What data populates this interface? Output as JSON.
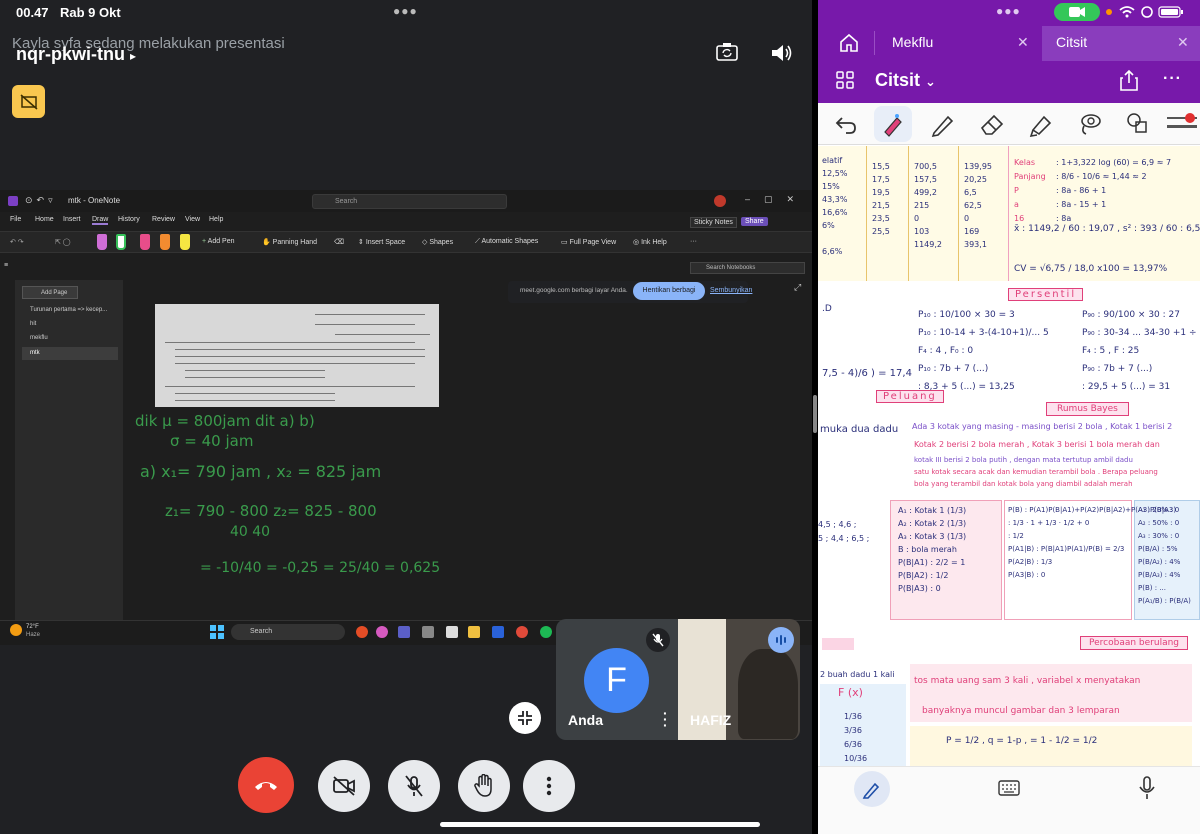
{
  "status": {
    "time": "00.47",
    "date": "Rab 9 Okt"
  },
  "meet": {
    "presenting_text": "Kayla syfa sedang melakukan presentasi",
    "meeting_code": "nqr-pkwi-tnu",
    "share_bar": {
      "text": "meet.google.com berbagi layar Anda.",
      "stop_label": "Hentikan berbagi",
      "hide_label": "Sembunyikan"
    },
    "participants": [
      {
        "name": "Anda",
        "initial": "F",
        "muted": true
      },
      {
        "name": "HAFIZ",
        "speaking": true
      }
    ],
    "controls": [
      "end-call",
      "camera-off",
      "mic-off",
      "raise-hand",
      "more-options"
    ]
  },
  "onenote_desktop": {
    "window_title": "mtk - OneNote",
    "search_placeholder": "Search",
    "menu": [
      "File",
      "Home",
      "Insert",
      "Draw",
      "History",
      "Review",
      "View",
      "Help"
    ],
    "active_menu": "Draw",
    "sticky_notes": "Sticky Notes",
    "share": "Share",
    "ribbon": {
      "add_pen": "Add Pen",
      "panning_hand": "Panning Hand",
      "insert_space": "Insert Space",
      "shapes": "Shapes",
      "automatic_shapes": "Automatic Shapes",
      "full_page_view": "Full Page View",
      "ink_help": "Ink Help"
    },
    "search_notebooks": "Search Notebooks",
    "add_page": "Add Page",
    "pages": [
      "Turunan pertama => kecep...",
      "hit",
      "mekflu",
      "mtk"
    ],
    "selected_page": "mtk",
    "handwriting": {
      "line1": "dik  μ = 800jam     dit a) b)",
      "line2": "σ = 40 jam",
      "line3": "a)  x₁= 790 jam , x₂ = 825 jam",
      "line4": "z₁= 790 - 800       z₂= 825 - 800",
      "line5": "40                              40",
      "line6": "= -10/40  = -0,25          = 25/40 = 0,625"
    }
  },
  "windows_taskbar": {
    "temperature": "72°F",
    "condition": "Haze",
    "search": "Search"
  },
  "onenote_ipad": {
    "tabs": [
      "Mekflu",
      "Citsit"
    ],
    "active_tab": "Citsit",
    "notebook_title": "Citsit",
    "headings": {
      "persentil": "Persentil",
      "peluang": "Peluang",
      "rumus_bayes": "Rumus Bayes",
      "percobaan": "Percobaan berulang"
    },
    "texts": {
      "dua_dadu": "muka dua dadu",
      "bayes_line1": "Ada 3 kotak yang masing - masing berisi 2 bola , Kotak 1 berisi 2",
      "bayes_line2": "Kotak 2 berisi 2 bola merah , Kotak 3 berisi 1 bola merah dan",
      "var_acak": "tos mata uang  sam 3 kali , variabel x menyatakan",
      "banyak_muncul": "banyaknya muncul gambar dan 3 lemparan",
      "dadu_kali": "2 buah dadu 1 kali",
      "cv": "CV = √6,75 / 18,0  x100 = 13,97%",
      "p_values": "P = 1/2 , q = 1-p , = 1 - 1/2 = 1/2",
      "fx": "F (x)",
      "fx_vals": [
        "1/36",
        "3/36",
        "6/36",
        "10/36"
      ]
    }
  }
}
